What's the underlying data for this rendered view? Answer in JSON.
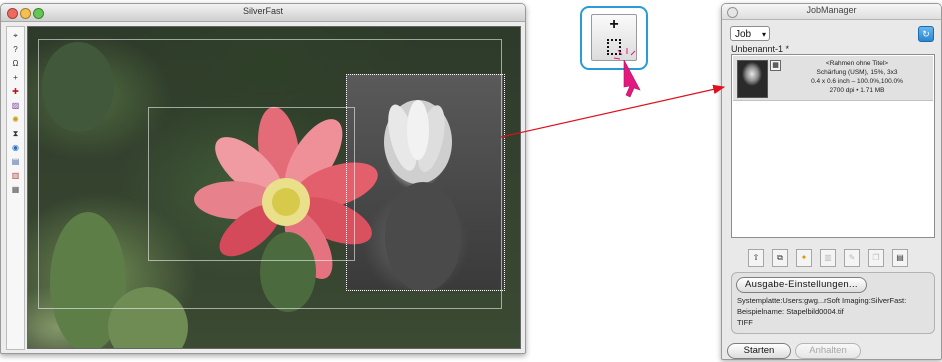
{
  "silverfast": {
    "title": "SilverFast",
    "toolbar": [
      {
        "name": "frame-icon",
        "glyph": "⌖"
      },
      {
        "name": "question-icon",
        "glyph": "?"
      },
      {
        "name": "loupe-icon",
        "glyph": "Ω"
      },
      {
        "name": "crop-add-icon",
        "glyph": "+"
      },
      {
        "name": "pipette-icon",
        "glyph": "✚"
      },
      {
        "name": "gradation-icon",
        "glyph": "▨"
      },
      {
        "name": "sun-icon",
        "glyph": "✺"
      },
      {
        "name": "hourglass-icon",
        "glyph": "⧗"
      },
      {
        "name": "globe-icon",
        "glyph": "◉"
      },
      {
        "name": "filter-icon",
        "glyph": "▤"
      },
      {
        "name": "color-icon",
        "glyph": "▥"
      },
      {
        "name": "scan-icon",
        "glyph": "▦"
      }
    ]
  },
  "tool_callout": {
    "plus": "+"
  },
  "jobmanager": {
    "title": "JobManager",
    "job_select": "Job",
    "job_name": "Unbenannt-1 *",
    "item": {
      "line1": "<Rahmen ohne Titel>",
      "line2": "Schärfung (USM), 15%, 3x3",
      "line3": "0.4 x 0.6 inch – 100.0%,100.0%",
      "line4": "2700 dpi • 1.71 MB"
    },
    "icons": [
      "add-frame-icon",
      "duplicate-icon",
      "bulb-icon",
      "trash-icon",
      "edit-icon",
      "copy-icon",
      "film-icon"
    ],
    "output_button": "Ausgabe-Einstellungen...",
    "output_lines": [
      "Systemplatte:Users:gwg...rSoft Imaging:SilverFast:",
      "Beispielname: Stapelbild0004.tif",
      "TIFF"
    ],
    "start_button": "Starten",
    "stop_button": "Anhalten"
  },
  "colors": {
    "callout_border": "#2a9bd6",
    "arrow_red": "#e0101e",
    "cursor_magenta": "#e21a7d"
  }
}
